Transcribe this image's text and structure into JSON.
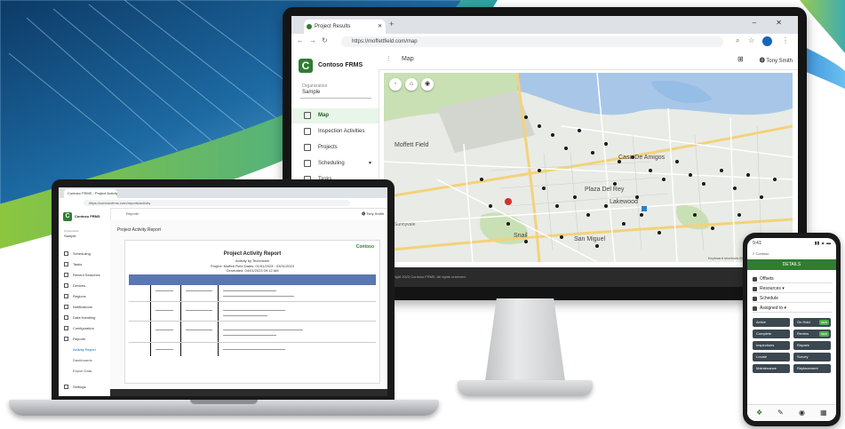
{
  "colors": {
    "brand_green": "#2e7d32",
    "accent_blue": "#1565c0",
    "sidebar_active_bg": "#e8f5e9",
    "report_header": "#5a77b0",
    "phone_button": "#3c4850"
  },
  "monitor": {
    "browser": {
      "tab_title": "Project Results",
      "new_tab": "+",
      "address": "https://moffettfield.com/map",
      "window_controls": "– ✕"
    },
    "app": {
      "logo_letter": "C",
      "logo_text": "Contoso FRMS",
      "org_label": "Organization",
      "org_value": "Sample",
      "sidebar_items": [
        {
          "label": "Map",
          "icon": "map-icon"
        },
        {
          "label": "Inspection Activities",
          "icon": "clipboard-icon"
        },
        {
          "label": "Projects",
          "icon": "folder-icon"
        },
        {
          "label": "Scheduling",
          "icon": "calendar-icon",
          "chevron": "▾"
        },
        {
          "label": "Tasks",
          "icon": "task-icon"
        }
      ],
      "topbar": {
        "menu_icon": "⋮",
        "title": "Map",
        "grid_icon": "⊞",
        "user": "⓿ Tony Smith"
      },
      "map": {
        "buttons": [
          "-",
          "⌂",
          "◉"
        ],
        "labels": [
          {
            "text": "Moffett Field",
            "size": "normal"
          },
          {
            "text": "Casa De Amigos",
            "size": "normal"
          },
          {
            "text": "Plaza Del Rey",
            "size": "normal"
          },
          {
            "text": "Lakewood",
            "size": "normal"
          },
          {
            "text": "Snail",
            "size": "normal"
          },
          {
            "text": "San Miguel",
            "size": "normal"
          },
          {
            "text": "Sunnyvale",
            "size": "small"
          }
        ],
        "attribution": "Keyboard shortcuts  Map data ©2023 Google  Terms"
      },
      "footer_text": "Copyright 2023 Contoso FRMS. All rights reserved."
    }
  },
  "laptop": {
    "browser": {
      "tab_title": "Contoso FRMS - Project Activity",
      "address": "https://contosofrms.com/reports/activity"
    },
    "app": {
      "logo_letter": "C",
      "logo_text": "Contoso FRMS",
      "org_label": "Organization",
      "org_value": "Sample",
      "topbar_title": "Reports",
      "user": "⓿ Tony Smith",
      "sidebar_items": [
        {
          "label": "Scheduling",
          "type": "main"
        },
        {
          "label": "Tasks",
          "type": "main"
        },
        {
          "label": "Recent Searches",
          "type": "main"
        },
        {
          "label": "Devices",
          "type": "main"
        },
        {
          "label": "Regions",
          "type": "main"
        },
        {
          "label": "Notifications",
          "type": "main"
        },
        {
          "label": "Data Handling",
          "type": "main"
        },
        {
          "label": "Configuration",
          "type": "main"
        },
        {
          "label": "Reports",
          "type": "main"
        },
        {
          "label": "Activity Report",
          "type": "sub"
        },
        {
          "label": "Dashboards",
          "type": "sub2"
        },
        {
          "label": "Export Data",
          "type": "sub2"
        },
        {
          "label": "Settings",
          "type": "main"
        }
      ],
      "page_title": "Project Activity Report",
      "report": {
        "logo": "Contoso",
        "title": "Project Activity Report",
        "subtitle": "Activity by Technician",
        "line1": "Project: Moffett Field  Dates: 01/01/2023 - 03/31/2023",
        "line2": "Generated: 04/01/2023 09:12 AM"
      }
    }
  },
  "phone": {
    "status_time": "9:41",
    "status_right": "▮▮ ▲ ▬",
    "top_text": "≡  Contoso",
    "header": "DETAILS",
    "fields": [
      {
        "label": "Offsets",
        "icon": "layers-icon"
      },
      {
        "label": "Resources ▾",
        "icon": "user-icon"
      },
      {
        "label": "Schedule",
        "icon": "pin-icon"
      },
      {
        "label": "Assigned to ▾",
        "icon": "heart-icon"
      }
    ],
    "buttons": [
      {
        "label": "Active",
        "tag": ""
      },
      {
        "label": "On Hold",
        "tag": "NEW"
      },
      {
        "label": "Complete",
        "tag": ""
      },
      {
        "label": "Review",
        "tag": "NEW"
      },
      {
        "label": "Inspections",
        "tag": ""
      },
      {
        "label": "Repairs",
        "tag": ""
      },
      {
        "label": "Locate",
        "tag": ""
      },
      {
        "label": "Survey",
        "tag": ""
      },
      {
        "label": "Maintenance",
        "tag": ""
      },
      {
        "label": "Replacement",
        "tag": ""
      }
    ],
    "nav": [
      "❖",
      "✎",
      "◉",
      "▦"
    ]
  }
}
